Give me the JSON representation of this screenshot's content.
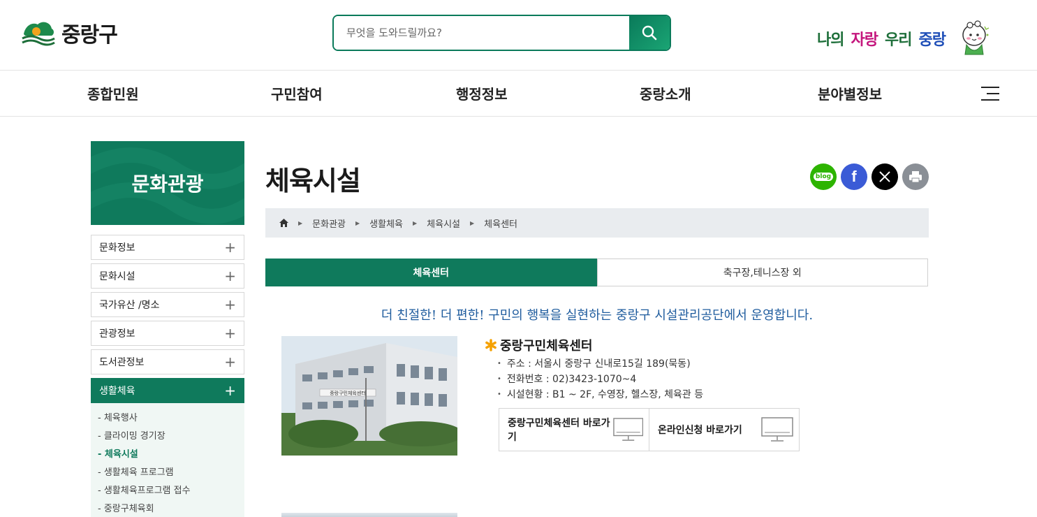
{
  "header": {
    "logo_text": "중랑구",
    "search_placeholder": "무엇을 도와드릴까요?",
    "slogan": [
      "나의",
      "자랑",
      "우리",
      "중랑"
    ]
  },
  "gnb": {
    "items": [
      "종합민원",
      "구민참여",
      "행정정보",
      "중랑소개",
      "분야별정보"
    ]
  },
  "side": {
    "title": "문화관광",
    "items": [
      "문화정보",
      "문화시설",
      "국가유산 /명소",
      "관광정보",
      "도서관정보",
      "생활체육"
    ],
    "sub_items": [
      "- 체육행사",
      "- 클라이밍 경기장",
      "- 체육시설",
      "- 생활체육 프로그램",
      "- 생활체육프로그램 접수",
      "- 중랑구체육회"
    ]
  },
  "content": {
    "title": "체육시설",
    "breadcrumb": [
      "문화관광",
      "생활체육",
      "체육시설",
      "체육센터"
    ],
    "tabs": [
      "체육센터",
      "축구장,테니스장 외"
    ],
    "intro": "더 친절한! 더 편한! 구민의 행복을 실현하는 중랑구 시설관리공단에서 운영합니다.",
    "facility": {
      "name": "중랑구민체육센터",
      "address": "주소 : 서울시 중랑구 신내로15길 189(묵동)",
      "phone": "전화번호 : 02)3423-1070~4",
      "status": "시설현황 : B1 ~ 2F, 수영장, 헬스장, 체육관 등",
      "sign_text": "중랑구민체육센터",
      "link1": "중랑구민체육센터 바로가기",
      "link2": "온라인신청 바로가기"
    }
  },
  "share": {
    "blog_label": "blog",
    "facebook_label": "f"
  },
  "colors": {
    "primary": "#0f7a5c",
    "intro_text": "#1f5c9e",
    "slogan_green": "#1e6f3a",
    "slogan_pink": "#c4167d",
    "slogan_blue": "#1f4fb8"
  }
}
